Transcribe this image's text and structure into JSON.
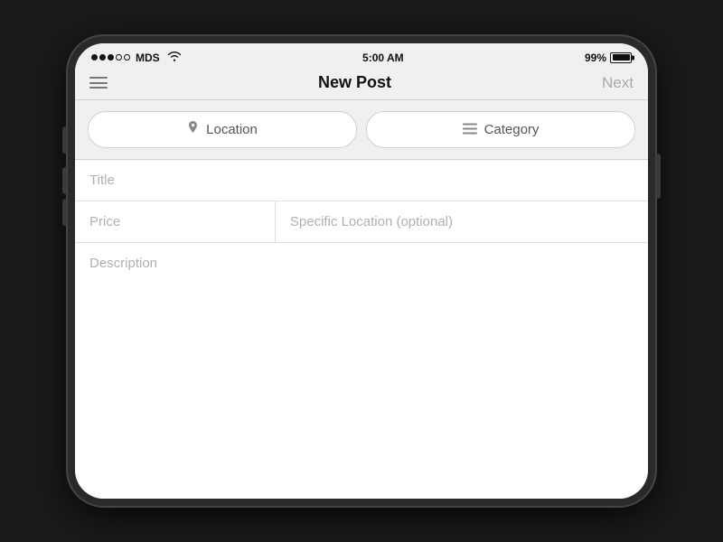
{
  "statusBar": {
    "carrier": "MDS",
    "time": "5:00 AM",
    "battery": "99%"
  },
  "navBar": {
    "title": "New Post",
    "nextLabel": "Next",
    "menuIcon": "≡"
  },
  "filterRow": {
    "locationBtn": {
      "icon": "📍",
      "label": "Location"
    },
    "categoryBtn": {
      "icon": "≡",
      "label": "Category"
    }
  },
  "form": {
    "titlePlaceholder": "Title",
    "pricePlaceholder": "Price",
    "specificLocationPlaceholder": "Specific Location (optional)",
    "descriptionPlaceholder": "Description"
  }
}
